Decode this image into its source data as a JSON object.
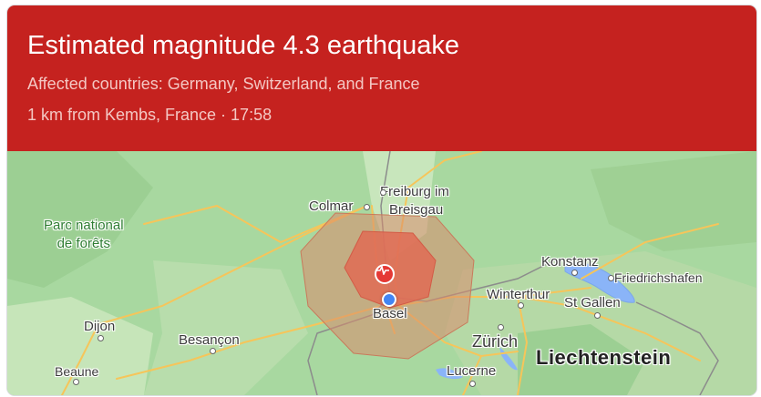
{
  "header": {
    "title": "Estimated magnitude 4.3 earthquake",
    "affected": "Affected countries: Germany, Switzerland, and France",
    "location_time": "1 km from Kembs, France · 17:58"
  },
  "map": {
    "park_label": [
      "Parc national",
      "de forêts"
    ],
    "cities": {
      "colmar": "Colmar",
      "freiburg_1": "Freiburg im",
      "freiburg_2": "Breisgau",
      "konstanz": "Konstanz",
      "friedrichshafen": "Friedrichshafen",
      "winterthur": "Winterthur",
      "st_gallen": "St Gallen",
      "basel": "Basel",
      "dijon": "Dijon",
      "besancon": "Besançon",
      "zurich": "Zürich",
      "beaune": "Beaune",
      "lucerne": "Lucerne"
    },
    "country": "Liechtenstein",
    "colors": {
      "header": "#c5221f",
      "land": "#a8d8a0",
      "epicenter": "#e53935",
      "location_pin": "#4285f4"
    }
  }
}
